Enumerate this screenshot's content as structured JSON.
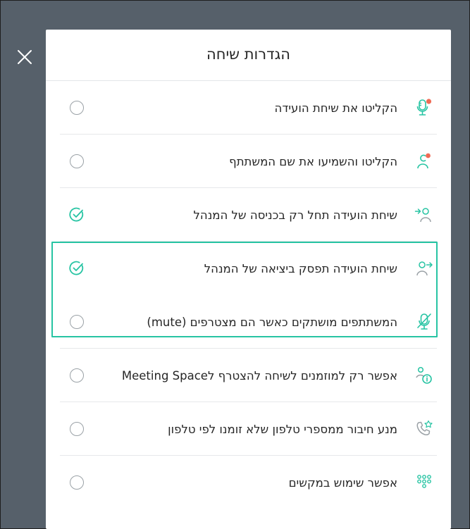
{
  "dialog": {
    "title": "הגדרות שיחה"
  },
  "colors": {
    "accent": "#27c4a3",
    "record_dot": "#ef6b55",
    "overlay": "#56606a"
  },
  "settings": [
    {
      "icon": "microphone-record-icon",
      "label": "הקליטו את שיחת הועידה",
      "checked": false
    },
    {
      "icon": "user-record-name-icon",
      "label": "הקליטו והשמיעו את שם המשתתף",
      "checked": false
    },
    {
      "icon": "user-enter-icon",
      "label": "שיחת הועידה תחל רק בכניסה של המנהל",
      "checked": true
    },
    {
      "icon": "user-exit-icon",
      "label": "שיחת הועידה תפסק ביציאה של המנהל",
      "checked": true
    },
    {
      "icon": "microphone-muted-icon",
      "label": "המשתתפים מושתקים כאשר הם מצטרפים (mute)",
      "checked": false
    },
    {
      "icon": "invited-users-icon",
      "label": "אפשר רק למוזמנים לשיחה להצטרף לMeeting Space",
      "checked": false
    },
    {
      "icon": "phone-block-icon",
      "label": "מנע חיבור ממספרי טלפון שלא זומנו לפי טלפון",
      "checked": false
    },
    {
      "icon": "keypad-icon",
      "label": "אפשר שימוש במקשים",
      "checked": false
    }
  ]
}
